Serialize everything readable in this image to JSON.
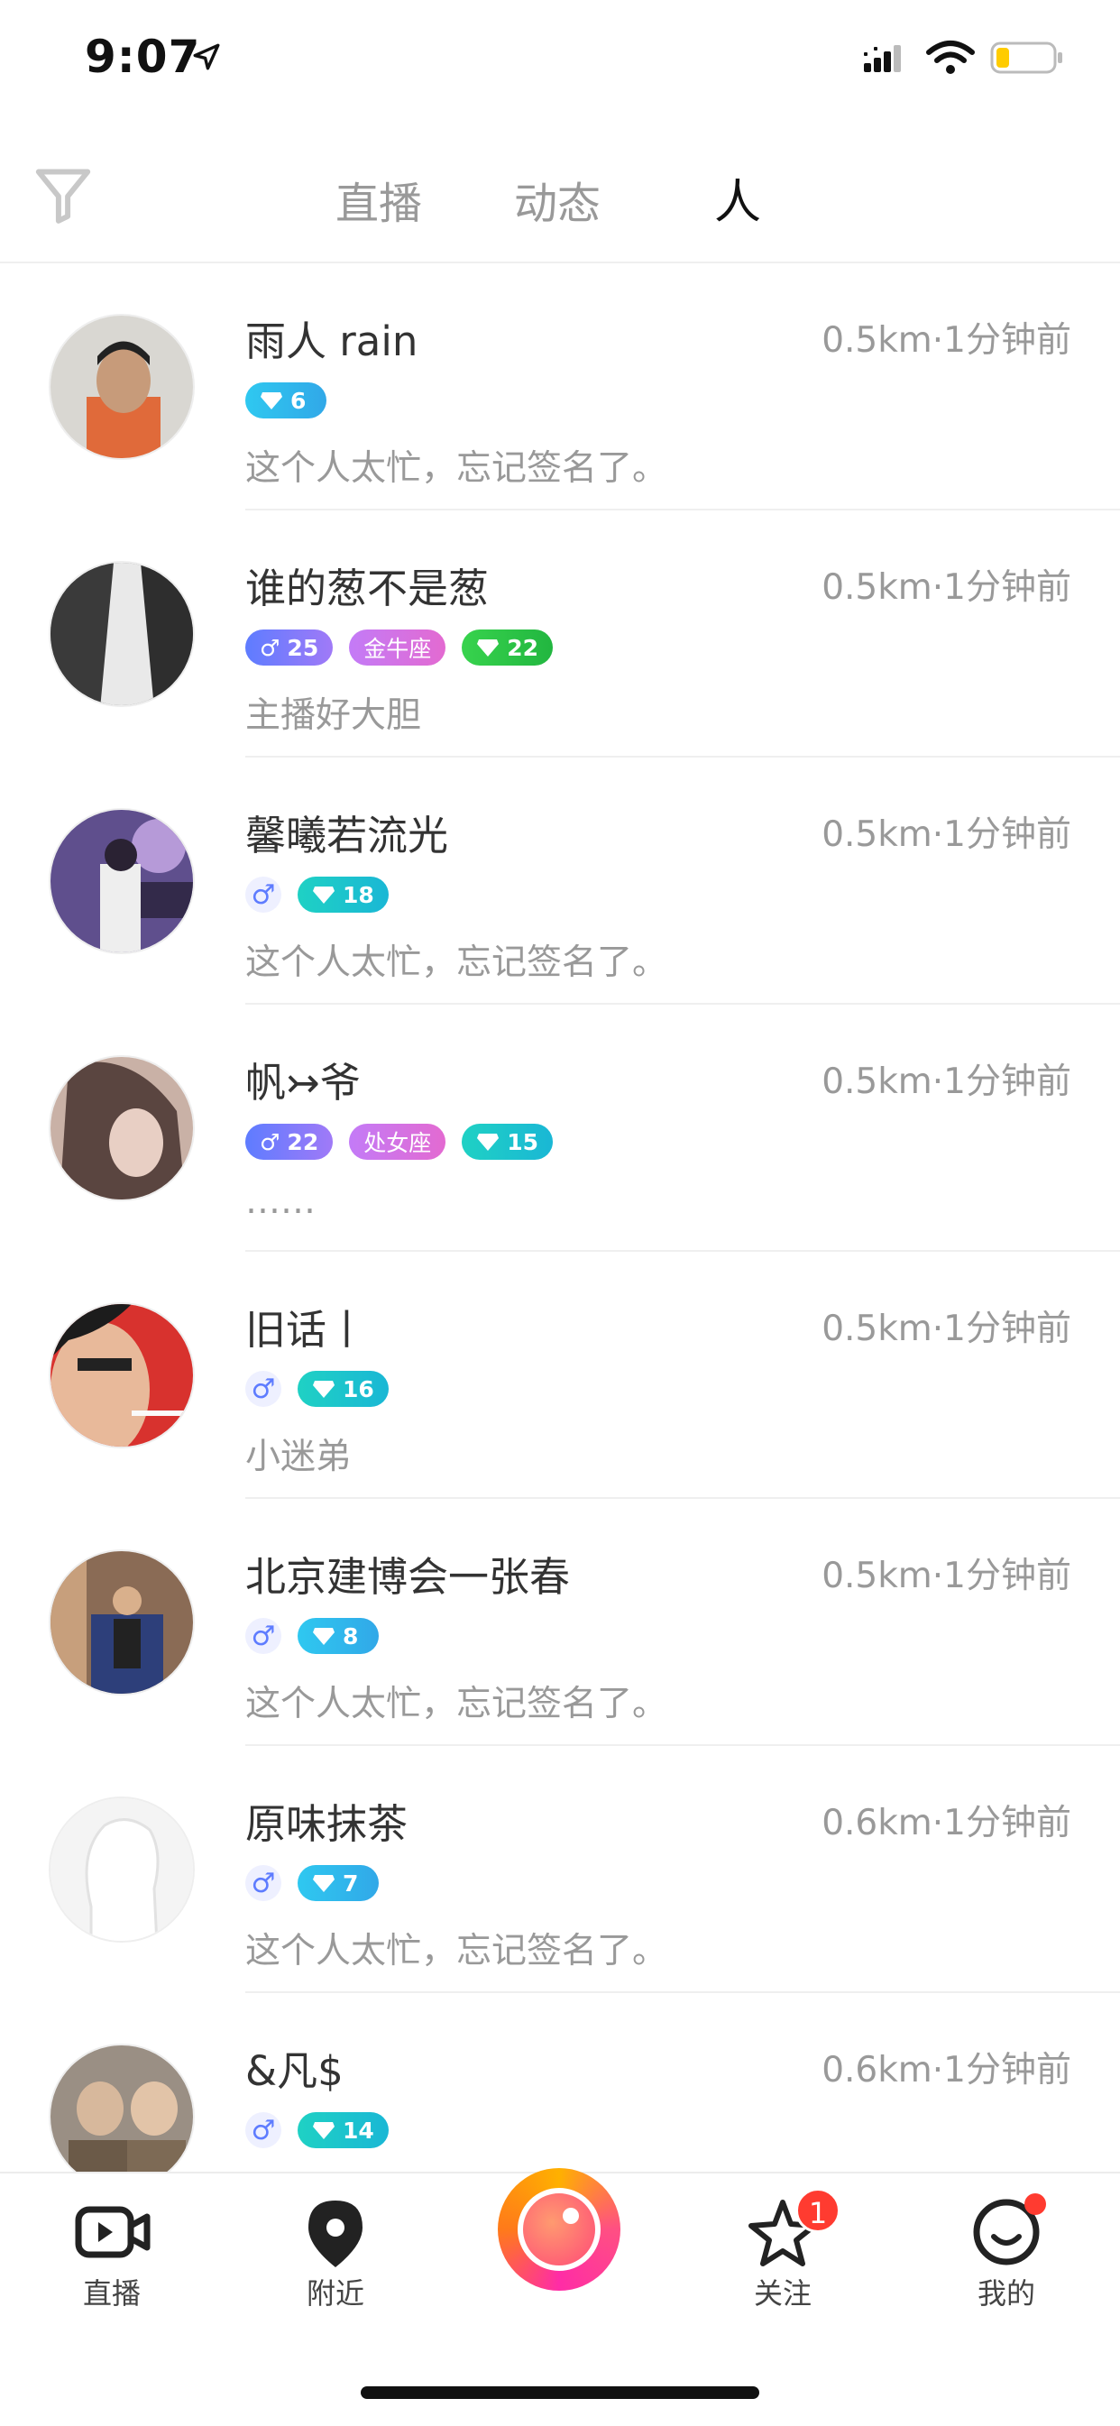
{
  "status_bar": {
    "time": "9:07"
  },
  "top_nav": {
    "tabs": [
      {
        "label": "直播",
        "active": false
      },
      {
        "label": "动态",
        "active": false
      },
      {
        "label": "人",
        "active": true
      }
    ]
  },
  "users": [
    {
      "name": "雨人 rain",
      "meta": "0.5km·1分钟前",
      "signature": "这个人太忙，忘记签名了。",
      "tags": [
        {
          "type": "gem-blue",
          "text": "6"
        }
      ]
    },
    {
      "name": "谁的葱不是葱",
      "meta": "0.5km·1分钟前",
      "signature": "主播好大胆",
      "tags": [
        {
          "type": "gender",
          "text": "25"
        },
        {
          "type": "zodiac",
          "text": "金牛座"
        },
        {
          "type": "gem-green",
          "text": "22"
        }
      ]
    },
    {
      "name": "馨曦若流光",
      "meta": "0.5km·1分钟前",
      "signature": "这个人太忙，忘记签名了。",
      "tags": [
        {
          "type": "gender-icon",
          "text": ""
        },
        {
          "type": "gem-teal",
          "text": "18"
        }
      ]
    },
    {
      "name": "帆↣爷",
      "meta": "0.5km·1分钟前",
      "signature": "……",
      "tags": [
        {
          "type": "gender",
          "text": "22"
        },
        {
          "type": "zodiac",
          "text": "处女座"
        },
        {
          "type": "gem-teal",
          "text": "15"
        }
      ]
    },
    {
      "name": "旧话丨",
      "meta": "0.5km·1分钟前",
      "signature": "小迷弟",
      "tags": [
        {
          "type": "gender-icon",
          "text": ""
        },
        {
          "type": "gem-teal",
          "text": "16"
        }
      ]
    },
    {
      "name": "北京建博会一张春",
      "meta": "0.5km·1分钟前",
      "signature": "这个人太忙，忘记签名了。",
      "tags": [
        {
          "type": "gender-icon",
          "text": ""
        },
        {
          "type": "gem-blue",
          "text": "8"
        }
      ]
    },
    {
      "name": "原味抹茶",
      "meta": "0.6km·1分钟前",
      "signature": "这个人太忙，忘记签名了。",
      "tags": [
        {
          "type": "gender-icon",
          "text": ""
        },
        {
          "type": "gem-blue",
          "text": "7"
        }
      ]
    },
    {
      "name": "&凡$",
      "meta": "0.6km·1分钟前",
      "signature": "",
      "tags": [
        {
          "type": "gender-icon",
          "text": ""
        },
        {
          "type": "gem-teal",
          "text": "14"
        }
      ]
    }
  ],
  "tab_bar": {
    "items": [
      {
        "label": "直播",
        "icon": "live-video-icon"
      },
      {
        "label": "附近",
        "icon": "location-pin-icon"
      },
      {
        "label": "",
        "icon": "camera-record-icon"
      },
      {
        "label": "关注",
        "icon": "star-icon",
        "badge": "1"
      },
      {
        "label": "我的",
        "icon": "smiley-profile-icon"
      }
    ]
  }
}
